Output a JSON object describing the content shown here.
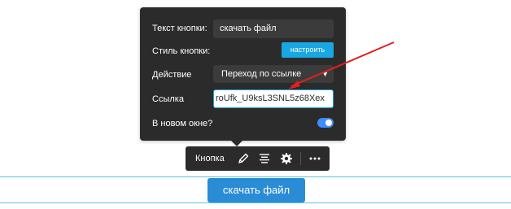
{
  "panel": {
    "button_text_label": "Текст кнопки:",
    "button_text_value": "скачать файл",
    "style_label": "Стиль кнопки:",
    "configure_label": "настроить",
    "action_label": "Действие",
    "action_value": "Переход по ссылке",
    "link_label": "Ссылка",
    "link_value": "roUfk_U9ksL3SNL5z68Xex",
    "new_window_label": "В новом окне?",
    "new_window_enabled": true
  },
  "toolbar": {
    "label": "Кнопка",
    "icons": [
      "pencil-icon",
      "align-icon",
      "gear-icon",
      "more-icon"
    ]
  },
  "cta": {
    "label": "скачать файл",
    "color": "#2b8cd6"
  },
  "colors": {
    "panel_bg": "#2b2b2b",
    "accent": "#18a7e0",
    "toggle": "#3f8cff",
    "annotation_arrow": "#e02020",
    "guide_lines": "#5cc4dd"
  }
}
